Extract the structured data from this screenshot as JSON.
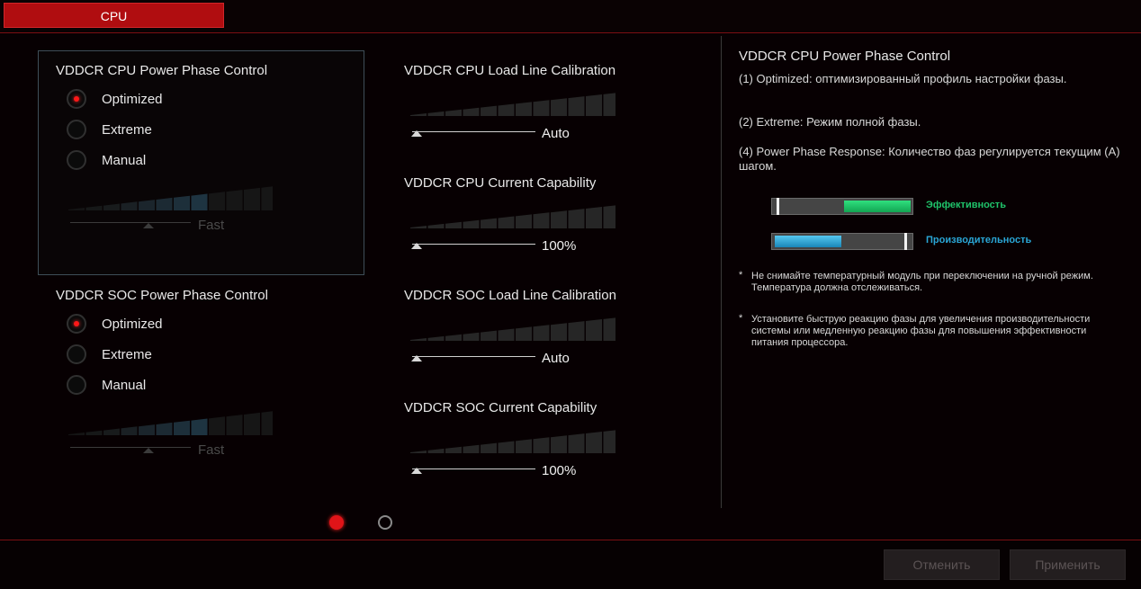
{
  "tabs": {
    "cpu": "CPU"
  },
  "cpu_phase": {
    "title": "VDDCR CPU Power Phase Control",
    "options": [
      "Optimized",
      "Extreme",
      "Manual"
    ],
    "selected": "Optimized",
    "slider_value": "Fast"
  },
  "soc_phase": {
    "title": "VDDCR SOC Power Phase Control",
    "options": [
      "Optimized",
      "Extreme",
      "Manual"
    ],
    "selected": "Optimized",
    "slider_value": "Fast"
  },
  "cpu_llc": {
    "title": "VDDCR CPU Load Line Calibration",
    "value": "Auto"
  },
  "cpu_current": {
    "title": "VDDCR CPU Current Capability",
    "value": "100%"
  },
  "soc_llc": {
    "title": "VDDCR SOC Load Line Calibration",
    "value": "Auto"
  },
  "soc_current": {
    "title": "VDDCR SOC Current Capability",
    "value": "100%"
  },
  "help": {
    "title": "VDDCR CPU Power Phase Control",
    "p1": "(1) Optimized: оптимизированный профиль  настройки фазы.",
    "p2": "(2) Extreme: Режим полной фазы.",
    "p3": "(4) Power Phase Response: Количество фаз регулируется текущим (A) шагом.",
    "meter_efficiency": "Эффективность",
    "meter_performance": "Производительность",
    "note1": "Не снимайте температурный модуль при переключении на ручной режим. Температура должна отслеживаться.",
    "note2": "Установите быструю реакцию фазы для увеличения производительности системы или медленную реакцию фазы для повышения эффективности питания процессора."
  },
  "pagination": {
    "pages": 2,
    "current": 1
  },
  "buttons": {
    "cancel": "Отменить",
    "apply": "Применить"
  },
  "colors": {
    "accent_red": "#b00d10",
    "efficiency_green": "#1fc36a",
    "performance_blue": "#2aa6d6"
  }
}
